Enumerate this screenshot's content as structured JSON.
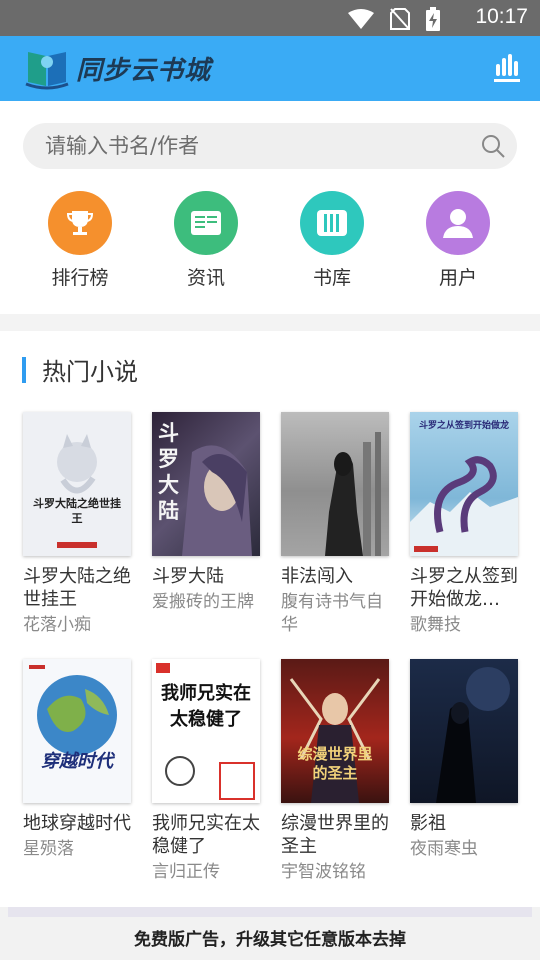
{
  "status_bar": {
    "time": "10:17"
  },
  "app_bar": {
    "logo_text": "同步云书城"
  },
  "search": {
    "placeholder": "请输入书名/作者"
  },
  "nav": [
    {
      "label": "排行榜",
      "color": "#f5902d",
      "icon": "trophy-icon"
    },
    {
      "label": "资讯",
      "color": "#3dbd7d",
      "icon": "news-icon"
    },
    {
      "label": "书库",
      "color": "#2ec8bd",
      "icon": "library-icon"
    },
    {
      "label": "用户",
      "color": "#b87be0",
      "icon": "user-icon"
    }
  ],
  "section": {
    "title": "热门小说"
  },
  "books": [
    {
      "title": "斗罗大陆之绝世挂王",
      "author": "花落小痴",
      "cover_text": "斗罗大陆之绝世挂王",
      "cover_color": "#eef0f4"
    },
    {
      "title": "斗罗大陆",
      "author": "爱搬砖的王牌",
      "cover_text": "斗罗大陆",
      "cover_color": "#3e3450"
    },
    {
      "title": "非法闯入",
      "author": "腹有诗书气自华",
      "cover_text": "",
      "cover_color": "#8c8c8c"
    },
    {
      "title": "斗罗之从签到开始做龙…",
      "author": "歌舞技",
      "cover_text": "斗罗之从签到开始做龙",
      "cover_color": "#7fb7d8"
    },
    {
      "title": "地球穿越时代",
      "author": "星殒落",
      "cover_text": "穿越时代",
      "cover_color": "#3c87c8"
    },
    {
      "title": "我师兄实在太稳健了",
      "author": "言归正传",
      "cover_text": "我师兄实在太稳健了",
      "cover_color": "#ffffff"
    },
    {
      "title": "综漫世界里的圣主",
      "author": "宇智波铭铭",
      "cover_text": "综漫世界里的圣主",
      "cover_color": "#7a2018"
    },
    {
      "title": "影祖",
      "author": "夜雨寒虫",
      "cover_text": "",
      "cover_color": "#1a2840"
    }
  ],
  "ad": {
    "text": "免费版广告，升级其它任意版本去掉"
  }
}
